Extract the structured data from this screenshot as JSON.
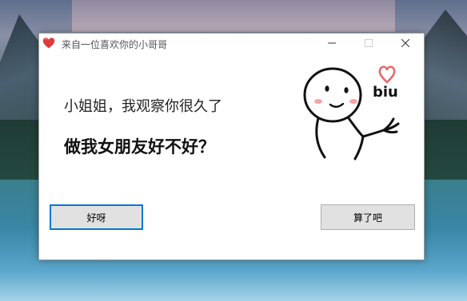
{
  "window": {
    "title": "来自一位喜欢你的小哥哥",
    "icon": "heart-icon",
    "controls": [
      "minimize-icon",
      "maximize-icon",
      "close-icon"
    ]
  },
  "content": {
    "line1": "小姐姐，我观察你很久了",
    "line2": "做我女朋友好不好？",
    "sticker_text": "biu"
  },
  "buttons": {
    "yes_label": "好呀",
    "no_label": "算了吧"
  },
  "colors": {
    "accent_border": "#0078d7",
    "button_bg": "#e1e1e1",
    "heart": "#e03a3a"
  }
}
